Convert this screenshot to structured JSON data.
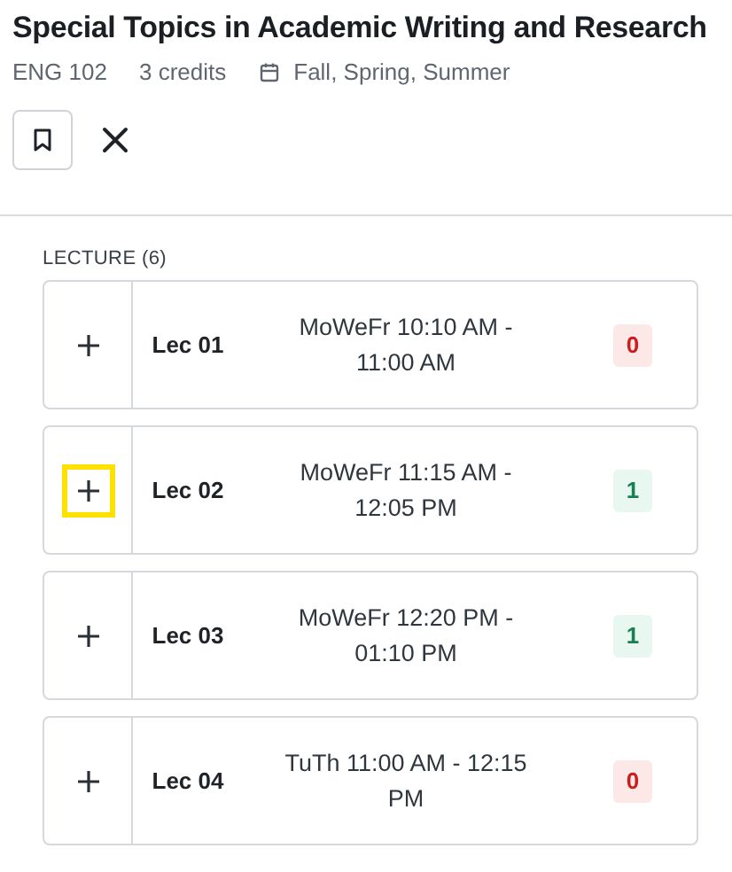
{
  "course": {
    "title": "Special Topics in Academic Writing and Research",
    "code": "ENG 102",
    "credits": "3 credits",
    "terms": "Fall, Spring, Summer"
  },
  "group": {
    "heading": "LECTURE (6)"
  },
  "sections": [
    {
      "name": "Lec 01",
      "time": "MoWeFr 10:10 AM - 11:00 AM",
      "seats": "0",
      "full": true,
      "focused": false
    },
    {
      "name": "Lec 02",
      "time": "MoWeFr 11:15 AM - 12:05 PM",
      "seats": "1",
      "full": false,
      "focused": true
    },
    {
      "name": "Lec 03",
      "time": "MoWeFr 12:20 PM - 01:10 PM",
      "seats": "1",
      "full": false,
      "focused": false
    },
    {
      "name": "Lec 04",
      "time": "TuTh 11:00 AM - 12:15 PM",
      "seats": "0",
      "full": true,
      "focused": false
    }
  ]
}
